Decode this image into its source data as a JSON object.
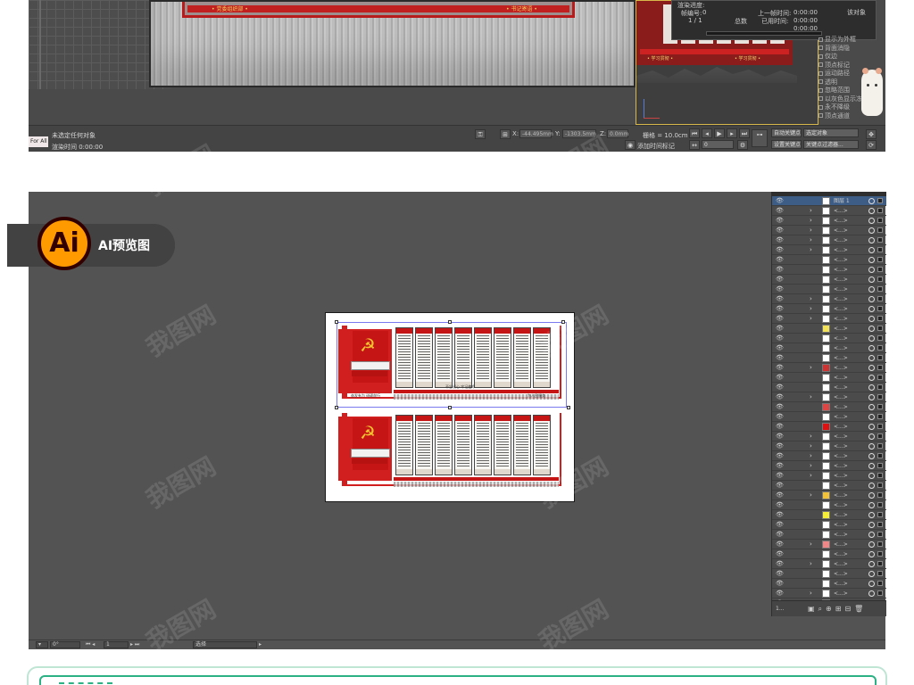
{
  "top_panel": {
    "render_banner_tags": [
      "• 党委组织部 •",
      "• 书记寄语 •"
    ],
    "viewport_footer_tags": [
      "• 学习贯彻 •",
      "• 学习贯彻 •"
    ],
    "render_dialog": {
      "title": "渲染进度:",
      "frame_label": "帧编号:",
      "frame_value": "0",
      "progress_label": "1 / 1",
      "total_label": "总数",
      "last_frame_label": "上一帧时间:",
      "last_frame_value": "0:00:00",
      "elapsed_label": "已用时间:",
      "elapsed_value": "0:00:00",
      "remaining_value": "0:00:00",
      "right_label": "该对象"
    },
    "right_checks": [
      "显示为外框",
      "背面消隐",
      "仅边",
      "顶点标记",
      "运动路径",
      "透明",
      "忽略范围",
      "以灰色显示冻结对象",
      "永不降级",
      "顶点通道"
    ],
    "status": {
      "script_tag": "For All",
      "msg_line1": "未选定任何对象",
      "msg_line2": "渲染时间  0:00:00",
      "x_label": "X:",
      "x_value": "-44.495mm",
      "y_label": "Y:",
      "y_value": "-1303.5mm",
      "z_label": "Z:",
      "z_value": "0.0mm",
      "grid_label": "栅格 = 10.0cm",
      "add_tag_label": "添加时间标记",
      "frame_field": "0",
      "auto_key": "自动关键点",
      "selected_obj": "选定对象",
      "set_key": "设置关键点",
      "key_filter": "关键点过滤器..."
    }
  },
  "ai_badge": {
    "logo_text": "Ai",
    "label": "AI预览图"
  },
  "artboard": {
    "cap_top_left": "奋发有为 砥砺前行",
    "cap_top_right": "为人民服务",
    "cap_bottom_mid": "不忘初心 牢记使命"
  },
  "layers_panel": {
    "top_row_name": "图层 1",
    "row_name": "<...>",
    "bottom_count": "1..."
  },
  "ai_status": {
    "zoom": "0°",
    "page": "1",
    "tool": "选择"
  },
  "watermark": "我图网"
}
